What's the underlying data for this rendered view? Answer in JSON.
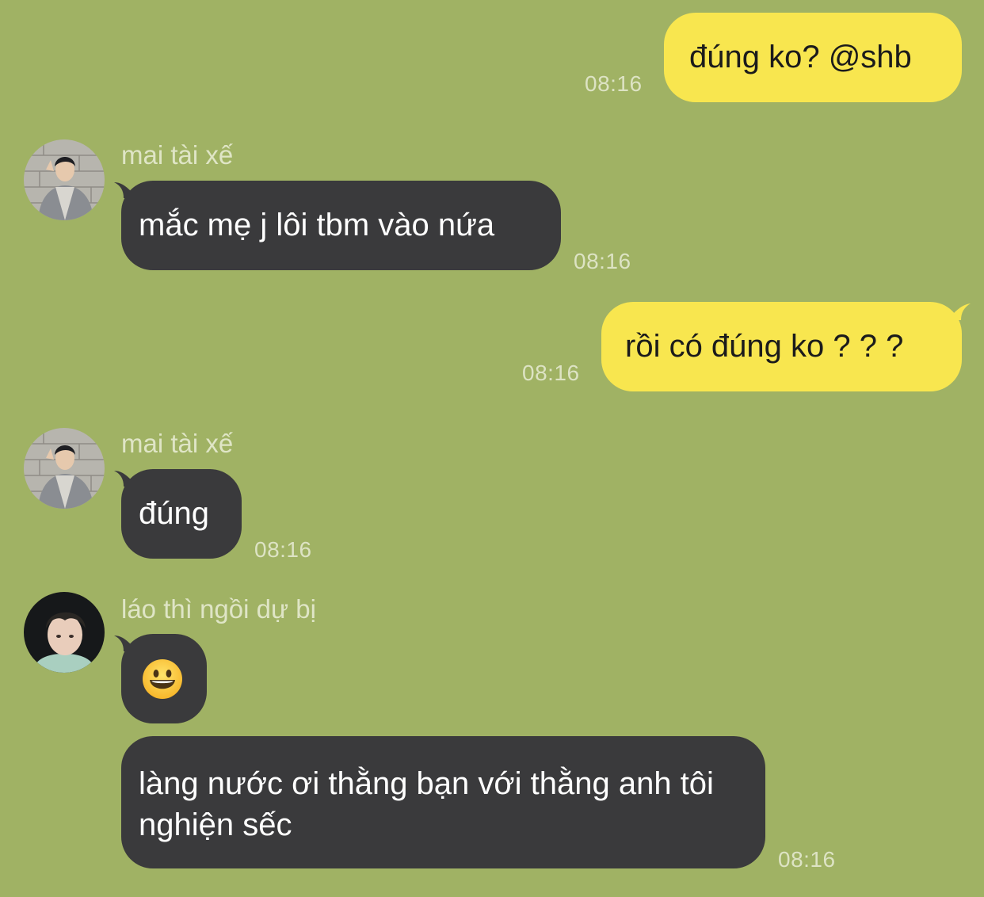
{
  "theme": {
    "background": "#a0b264",
    "outgoing_bubble": "#f8e64f",
    "incoming_bubble": "#3a3a3c",
    "timestamp_color": "#dde3c4"
  },
  "messages": [
    {
      "direction": "out",
      "text": "đúng ko? @shb",
      "time": "08:16"
    },
    {
      "direction": "in",
      "sender": "mai tài xế",
      "avatar": "photo-avatar-mai",
      "text": "mắc mẹ j lôi tbm vào nứa",
      "time": "08:16"
    },
    {
      "direction": "out",
      "text": "rồi có đúng ko ? ? ?",
      "time": "08:16"
    },
    {
      "direction": "in",
      "sender": "mai tài xế",
      "avatar": "photo-avatar-mai",
      "text": "đúng",
      "time": "08:16"
    },
    {
      "direction": "in",
      "sender": "láo thì ngồi dự bị",
      "avatar": "photo-avatar-lao",
      "emoji": "grinning-face-emoji"
    },
    {
      "direction": "in",
      "text": "làng nước ơi thằng bạn với thằng anh tôi nghiện sếc",
      "time": "08:16"
    }
  ]
}
